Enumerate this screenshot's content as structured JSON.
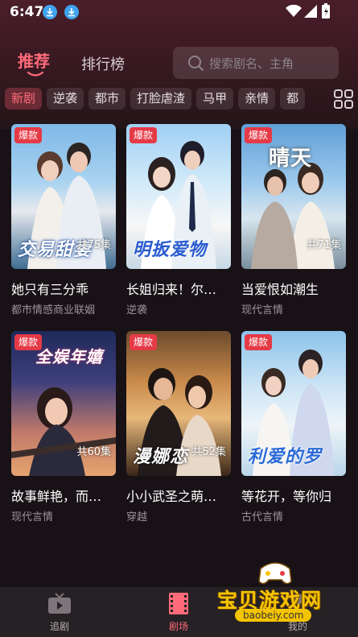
{
  "status_bar": {
    "time": "6:47"
  },
  "header": {
    "tabs": [
      {
        "label": "推荐",
        "active": true
      },
      {
        "label": "排行榜",
        "active": false
      }
    ],
    "search": {
      "placeholder": "搜索剧名、主角"
    }
  },
  "categories": [
    {
      "label": "新剧",
      "active": true
    },
    {
      "label": "逆袭",
      "active": false
    },
    {
      "label": "都市",
      "active": false
    },
    {
      "label": "打脸虐渣",
      "active": false
    },
    {
      "label": "马甲",
      "active": false
    },
    {
      "label": "亲情",
      "active": false
    },
    {
      "label": "都",
      "active": false
    }
  ],
  "dramas": [
    {
      "title": "她只有三分乖",
      "genre": "都市情感商业联姻",
      "badge": "爆款",
      "episodes": "共75集",
      "poster_text": "交易甜妻"
    },
    {
      "title": "长姐归来！尔…",
      "genre": "逆袭",
      "badge": "爆款",
      "episodes": "",
      "poster_text": "明扳爱物"
    },
    {
      "title": "当爱恨如潮生",
      "genre": "现代言情",
      "badge": "爆款",
      "episodes": "共71集",
      "poster_text": "晴天"
    },
    {
      "title": "故事鲜艳，而…",
      "genre": "现代言情",
      "badge": "爆款",
      "episodes": "共60集",
      "poster_text": "全娱年嬉"
    },
    {
      "title": "小小武圣之萌…",
      "genre": "穿越",
      "badge": "爆款",
      "episodes": "共52集",
      "poster_text": "漫娜恋"
    },
    {
      "title": "等花开，等你归",
      "genre": "古代言情",
      "badge": "爆款",
      "episodes": "",
      "poster_text": "利爱的罗"
    }
  ],
  "bottom_nav": [
    {
      "label": "追剧",
      "icon": "tv-icon",
      "active": false
    },
    {
      "label": "剧场",
      "icon": "film-icon",
      "active": true
    },
    {
      "label": "我的",
      "icon": "user-icon",
      "active": false
    }
  ],
  "watermark": {
    "text": "宝贝游戏网",
    "url": "baobeiy.com"
  },
  "colors": {
    "accent": "#ff6b7a",
    "badge": "#e53a46",
    "background": "#181217"
  }
}
